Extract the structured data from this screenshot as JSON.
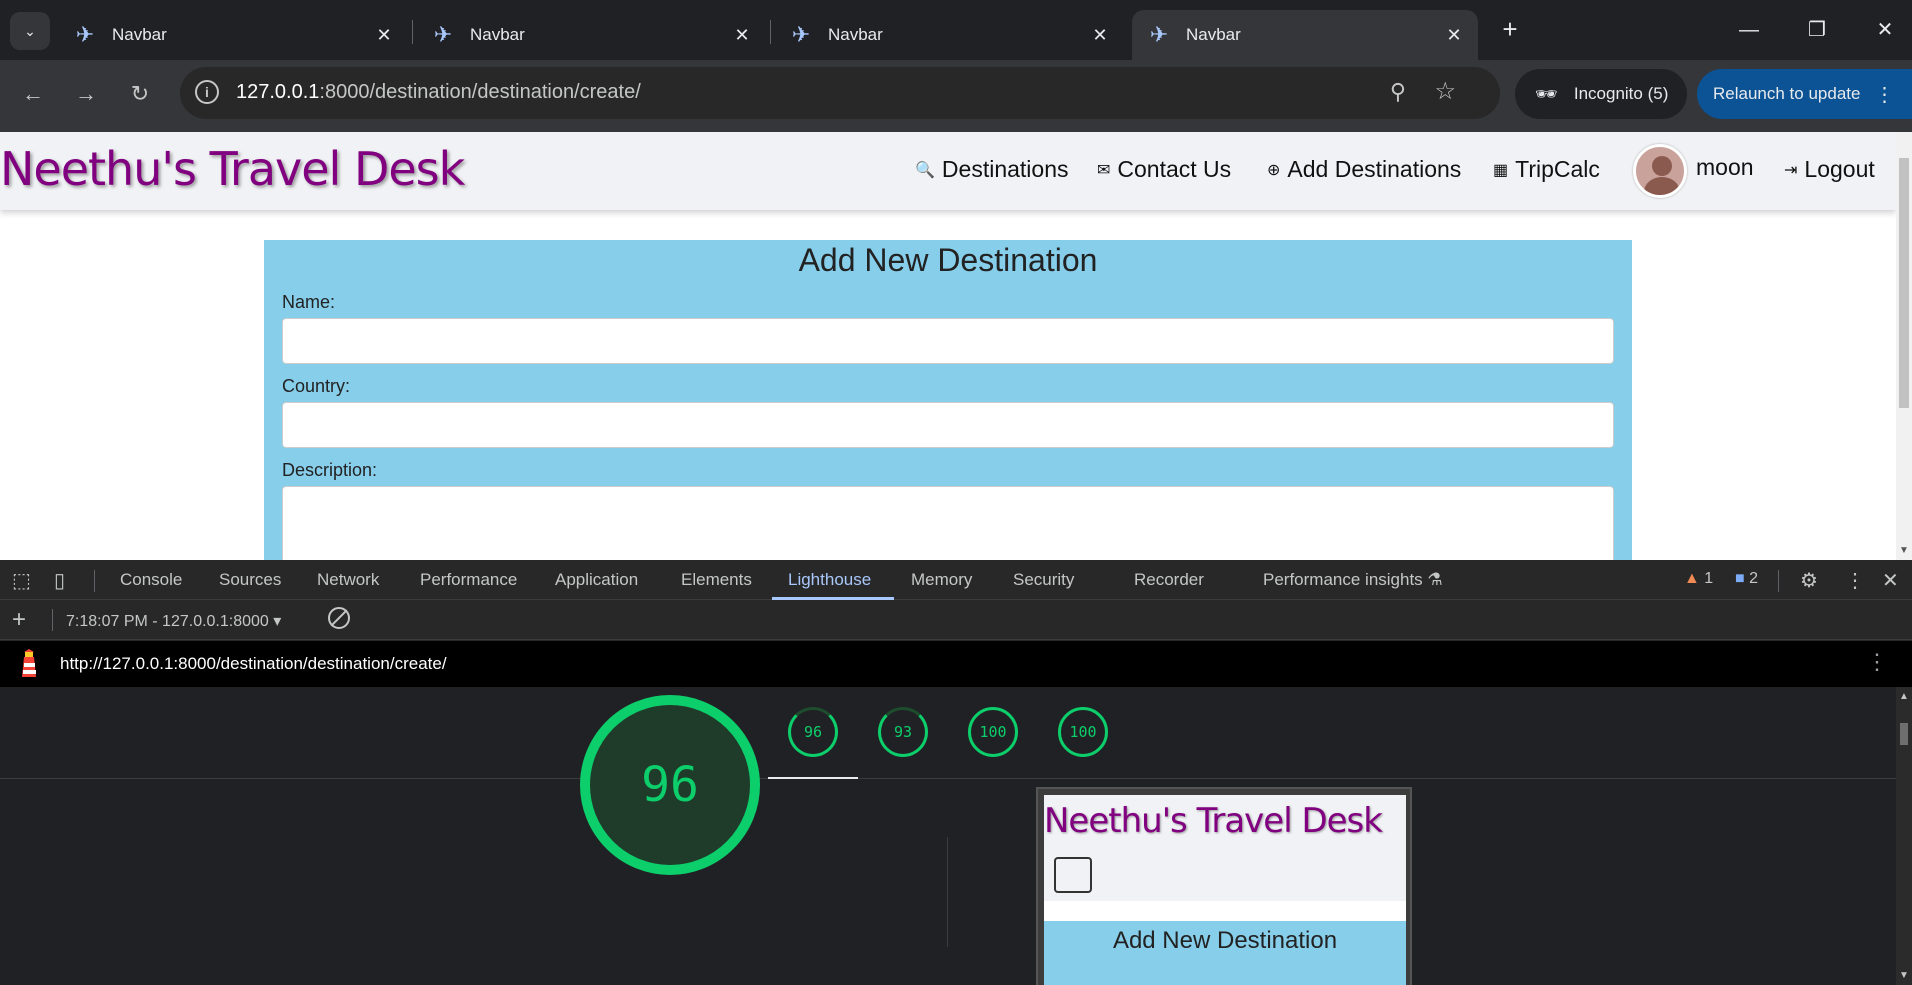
{
  "browser": {
    "tabs": [
      {
        "title": "Navbar",
        "active": false
      },
      {
        "title": "Navbar",
        "active": false
      },
      {
        "title": "Navbar",
        "active": false
      },
      {
        "title": "Navbar",
        "active": true
      }
    ],
    "url_host": "127.0.0.1",
    "url_rest": ":8000/destination/destination/create/",
    "incognito_label": "Incognito (5)",
    "relaunch_label": "Relaunch to update"
  },
  "site": {
    "brand": "Neethu's Travel Desk",
    "nav": {
      "destinations": "Destinations",
      "contact": "Contact Us",
      "add": "Add Destinations",
      "tripcalc": "TripCalc",
      "user": "moon",
      "logout": "Logout"
    },
    "form": {
      "title": "Add New Destination",
      "name_label": "Name:",
      "country_label": "Country:",
      "description_label": "Description:",
      "name_value": "",
      "country_value": "",
      "description_value": ""
    }
  },
  "devtools": {
    "tabs": [
      "Console",
      "Sources",
      "Network",
      "Performance",
      "Application",
      "Elements",
      "Lighthouse",
      "Memory",
      "Security",
      "Recorder",
      "Performance insights"
    ],
    "active_tab": "Lighthouse",
    "warnings": "1",
    "messages": "2",
    "report_selector": "7:18:07 PM - 127.0.0.1:8000",
    "lighthouse_url": "http://127.0.0.1:8000/destination/destination/create/",
    "scores": [
      "96",
      "93",
      "100",
      "100"
    ],
    "main_score": "96",
    "accent_color": "#0cce6b"
  }
}
